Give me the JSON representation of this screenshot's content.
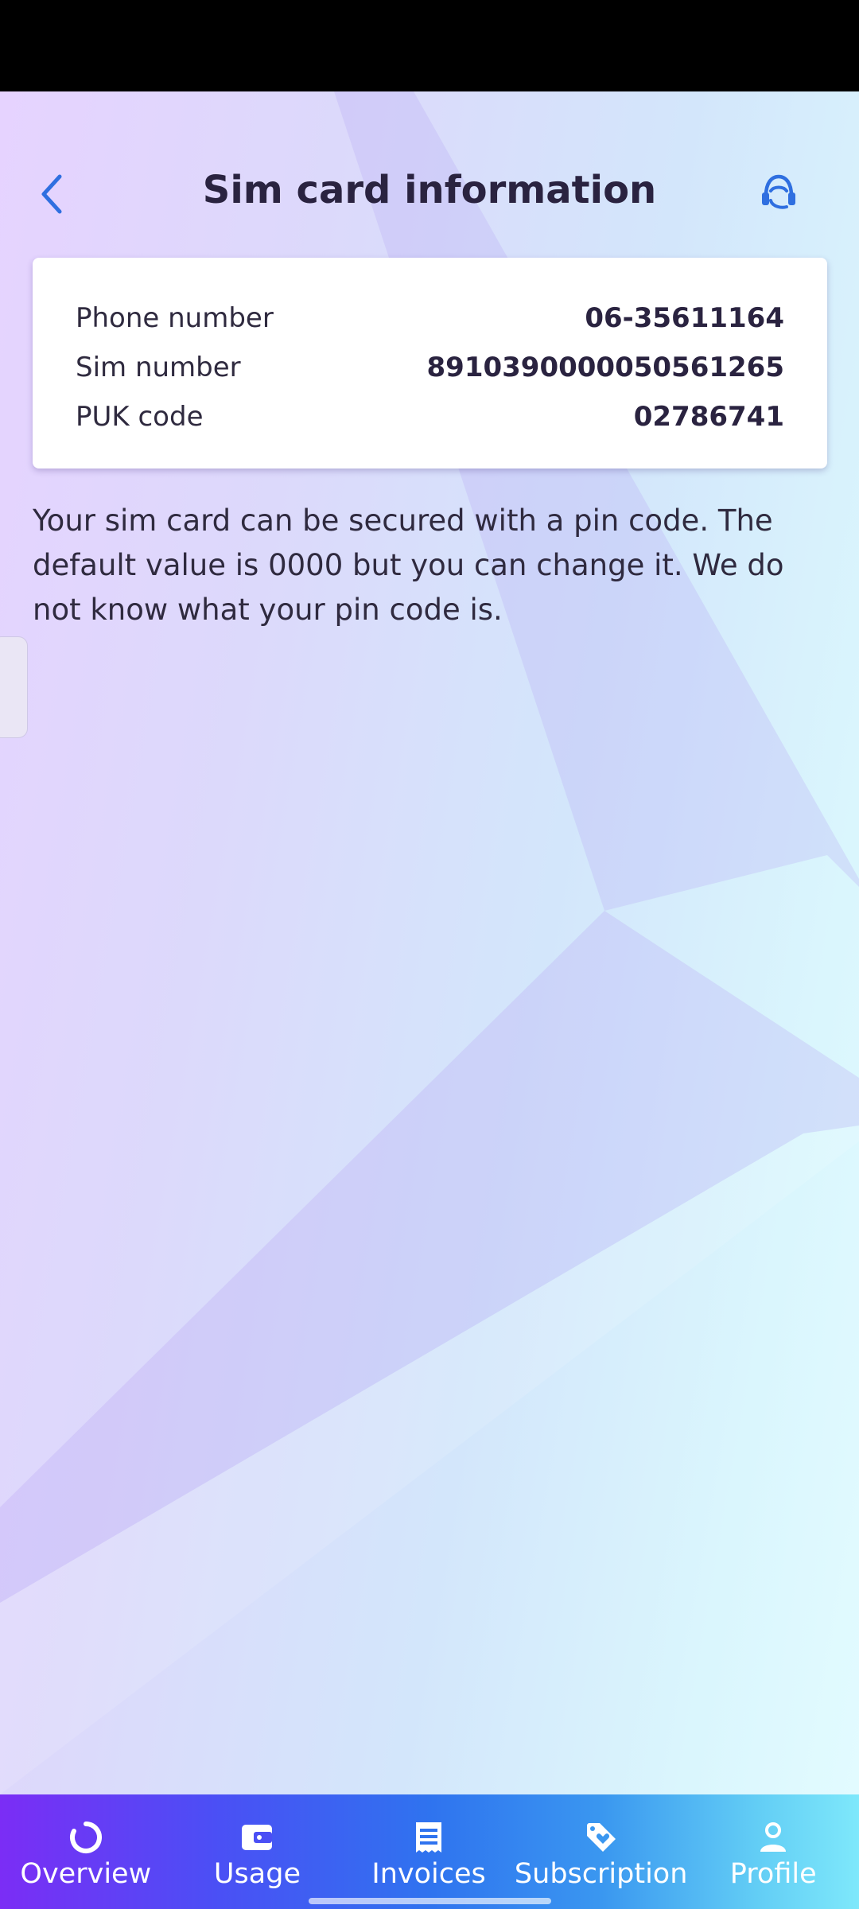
{
  "header": {
    "title": "Sim card information",
    "back_icon": "chevron-left-icon",
    "support_icon": "headset-icon"
  },
  "sim_info": {
    "rows": [
      {
        "label": "Phone number",
        "value": "06-35611164"
      },
      {
        "label": "Sim number",
        "value": "8910390000050561265"
      },
      {
        "label": "PUK code",
        "value": "02786741"
      }
    ]
  },
  "description": "Your sim card can be secured with a pin code. The default value is 0000 but you can change it. We do not know what your pin code is.",
  "nav": {
    "items": [
      {
        "label": "Overview",
        "icon": "overview-ring-icon"
      },
      {
        "label": "Usage",
        "icon": "wallet-icon"
      },
      {
        "label": "Invoices",
        "icon": "receipt-icon"
      },
      {
        "label": "Subscription",
        "icon": "tag-heart-icon"
      },
      {
        "label": "Profile",
        "icon": "person-icon"
      }
    ]
  },
  "colors": {
    "accent": "#2f6fe0",
    "title_text": "#2a2340",
    "nav_gradient_start": "#7b2df5",
    "nav_gradient_end": "#7ee8fb"
  }
}
